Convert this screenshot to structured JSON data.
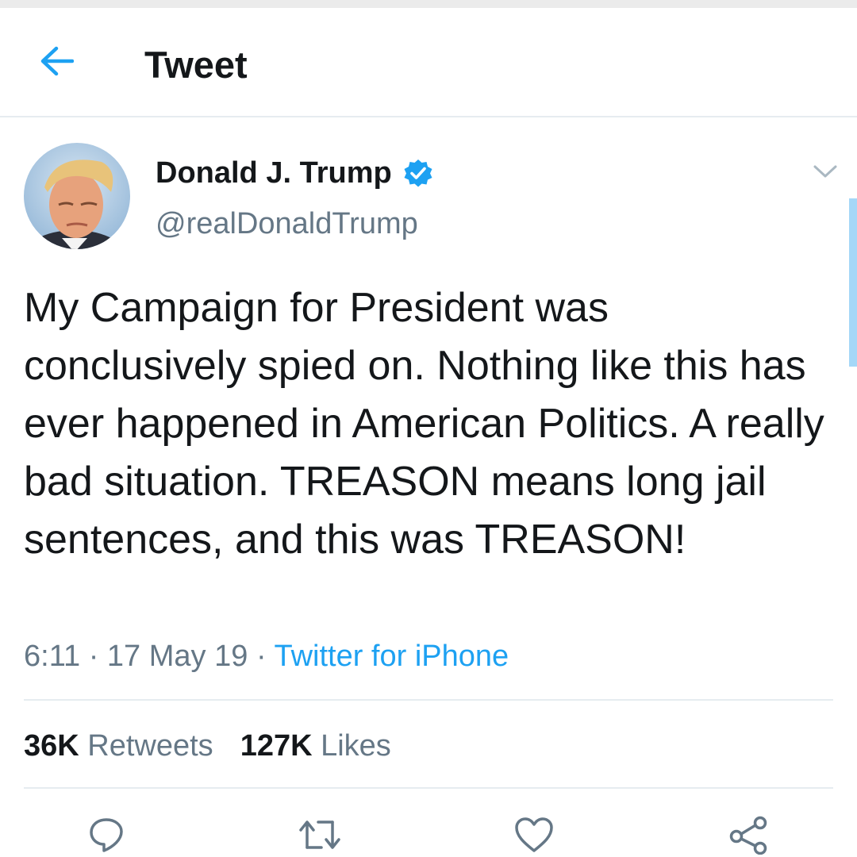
{
  "header": {
    "title": "Tweet",
    "back_icon": "arrow-left-icon",
    "accent_color": "#1da1f2"
  },
  "tweet": {
    "author": {
      "name": "Donald J. Trump",
      "handle": "@realDonaldTrump",
      "verified": true,
      "verified_icon": "verified-badge-icon"
    },
    "text": "My Campaign for President was conclusively spied on. Nothing like this has ever happened in American Politics. A really bad situation. TREASON means long jail sentences, and this was TREASON!",
    "time": "6:11",
    "date": "17 May 19",
    "separator": "·",
    "source": "Twitter for iPhone",
    "stats": {
      "retweets_count": "36K",
      "retweets_label": "Retweets",
      "likes_count": "127K",
      "likes_label": "Likes"
    }
  },
  "actions": [
    {
      "name": "reply",
      "icon": "reply-icon"
    },
    {
      "name": "retweet",
      "icon": "retweet-icon"
    },
    {
      "name": "like",
      "icon": "heart-icon"
    },
    {
      "name": "share",
      "icon": "share-icon"
    }
  ],
  "colors": {
    "text_primary": "#14171a",
    "text_secondary": "#657786",
    "link": "#1da1f2",
    "divider": "#e6ecf0"
  }
}
